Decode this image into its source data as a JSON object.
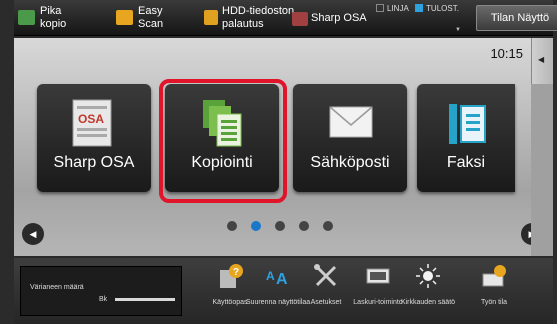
{
  "topbar": {
    "shortcuts": [
      {
        "label": "Pika kopio",
        "icon": "quick-copy-icon"
      },
      {
        "label": "Easy Scan",
        "icon": "easy-scan-icon"
      },
      {
        "label": "HDD-tiedoston palautus",
        "icon": "hdd-file-retrieve-icon"
      },
      {
        "label": "Sharp OSA",
        "icon": "sharp-osa-icon"
      }
    ],
    "status_line": "LINJA",
    "status_print": "TULOST.",
    "job_status_button": "Tilan Näyttö"
  },
  "clock": "10:15",
  "tiles": [
    {
      "label": "Sharp OSA",
      "icon": "sharp-osa-icon"
    },
    {
      "label": "Kopiointi",
      "icon": "copy-icon"
    },
    {
      "label": "Sähköposti",
      "icon": "email-icon"
    },
    {
      "label": "Faksi",
      "icon": "fax-icon"
    }
  ],
  "pager": {
    "total": 5,
    "active_index": 1
  },
  "colors": {
    "accent": "#1a77c9",
    "focus": "#e0152a",
    "active_status": "#2fa0e0"
  },
  "bottom": {
    "toner_label": "Värianeen määrä",
    "toner_color": "Bk",
    "items": [
      {
        "label": "Käyttöopas",
        "icon": "user-guide-icon"
      },
      {
        "label": "Suurenna näyttötilaa",
        "icon": "enlarge-display-icon"
      },
      {
        "label": "Asetukset",
        "icon": "settings-icon"
      },
      {
        "label": "Laskuri-toiminto",
        "icon": "counter-icon"
      },
      {
        "label": "Kirkkauden säätö",
        "icon": "brightness-icon"
      },
      {
        "label": "Työn tila",
        "icon": "job-status-icon"
      }
    ]
  }
}
